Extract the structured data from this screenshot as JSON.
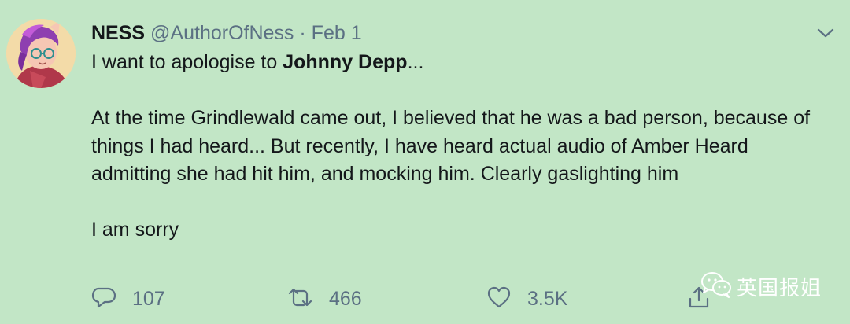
{
  "tweet": {
    "author_name": "NESS",
    "handle": "@AuthorOfNess",
    "separator": "·",
    "date": "Feb 1",
    "line1_prefix": "I want to apologise to ",
    "line1_mention": "Johnny Depp",
    "line1_suffix": "...",
    "paragraph2": "At the time Grindlewald came out, I believed that he was a bad person, because of things I had heard... But recently, I have heard actual audio of Amber Heard admitting she had hit him, and mocking him. Clearly gaslighting him",
    "paragraph3": "I am sorry"
  },
  "actions": {
    "reply_count": "107",
    "retweet_count": "466",
    "like_count": "3.5K"
  },
  "watermark": {
    "text": "英国报姐"
  },
  "icons": {
    "caret": "chevron-down-icon",
    "reply": "reply-icon",
    "retweet": "retweet-icon",
    "like": "heart-icon",
    "share": "share-icon",
    "watermark": "wechat-icon"
  },
  "colors": {
    "background": "#c2e6c6",
    "text": "#14171a",
    "secondary": "#5b7083"
  }
}
